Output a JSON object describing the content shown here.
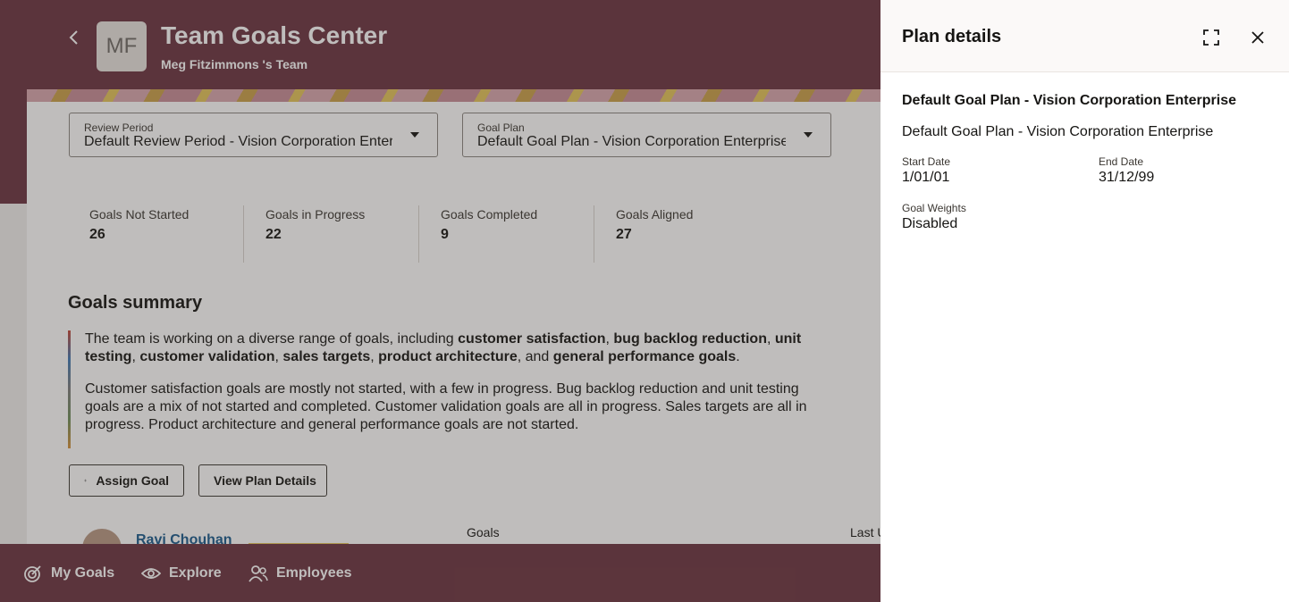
{
  "header": {
    "back_icon": "chevron-left-icon",
    "avatar_initials": "MF",
    "title": "Team Goals Center",
    "subtitle": "Meg Fitzimmons 's Team"
  },
  "filters": {
    "review_period": {
      "label": "Review Period",
      "value": "Default Review Period - Vision Corporation Enterprise"
    },
    "goal_plan": {
      "label": "Goal Plan",
      "value": "Default Goal Plan - Vision Corporation Enterprise"
    }
  },
  "stats": [
    {
      "label": "Goals Not Started",
      "value": "26"
    },
    {
      "label": "Goals in Progress",
      "value": "22"
    },
    {
      "label": "Goals Completed",
      "value": "9"
    },
    {
      "label": "Goals Aligned",
      "value": "27"
    }
  ],
  "summary": {
    "title": "Goals summary",
    "p1": {
      "t1": "The team is working on a diverse range of goals, including ",
      "b1": "customer satisfaction",
      "t2": ", ",
      "b2": "bug backlog reduction",
      "t3": ", ",
      "b3": "unit testing",
      "t4": ", ",
      "b4": "customer validation",
      "t5": ", ",
      "b5": "sales targets",
      "t6": ", ",
      "b6": "product architecture",
      "t7": ", and ",
      "b7": "general performance goals",
      "t8": "."
    },
    "p2": "Customer satisfaction goals are mostly not started, with a few in progress. Bug backlog reduction and unit testing goals are a mix of not started and completed. Customer validation goals are all in progress. Sales targets are all in progress. Product architecture and general performance goals are not started."
  },
  "actions": {
    "assign_goal": "Assign Goal",
    "view_plan_details": "View Plan Details"
  },
  "employee_row": {
    "name": "Ravi Chouhan",
    "goals_header": "Goals",
    "last_col_header": "Last U"
  },
  "bottom_nav": [
    {
      "label": "My Goals",
      "icon": "target-icon"
    },
    {
      "label": "Explore",
      "icon": "eye-icon"
    },
    {
      "label": "Employees",
      "icon": "people-icon"
    }
  ],
  "drawer": {
    "title": "Plan details",
    "plan_name": "Default Goal Plan - Vision Corporation Enterprise",
    "plan_description": "Default Goal Plan - Vision Corporation Enterprise",
    "start_date": {
      "label": "Start Date",
      "value": "1/01/01"
    },
    "end_date": {
      "label": "End Date",
      "value": "31/12/99"
    },
    "goal_weights": {
      "label": "Goal Weights",
      "value": "Disabled"
    }
  }
}
